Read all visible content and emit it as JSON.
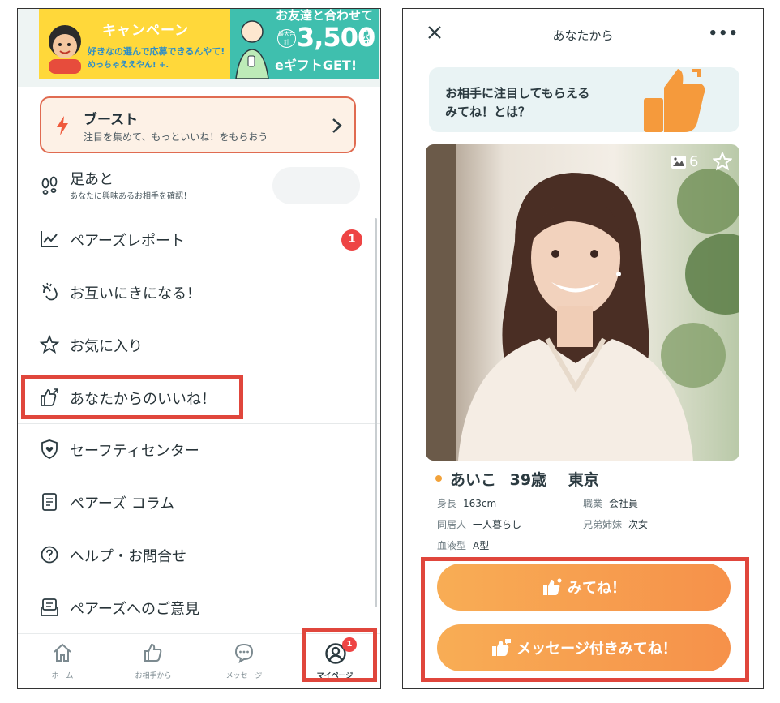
{
  "left": {
    "banner1": {
      "campaign": "キャンペーン",
      "line1": "好きなの選んで応募できるんやて!",
      "line2": "めっちゃええやん! +."
    },
    "banner2": {
      "top": "お友達と合わせて",
      "max": "最大合計",
      "amount": "3,500",
      "unit": "円分",
      "gift": "eギフトGET!"
    },
    "boost": {
      "title": "ブースト",
      "subtitle": "注目を集めて、もっといいね！をもらおう"
    },
    "menu": {
      "footprints": {
        "label": "足あと",
        "sub": "あなたに興味あるお相手を確認！",
        "icon": "footprints-icon"
      },
      "report": {
        "label": "ペアーズレポート",
        "badge": "1",
        "icon": "chart-line-icon"
      },
      "mutual": {
        "label": "お互いにきになる！",
        "icon": "clap-hands-icon"
      },
      "favorites": {
        "label": "お気に入り",
        "icon": "star-outline-icon"
      },
      "likes_sent": {
        "label": "あなたからのいいね！",
        "icon": "thumbs-up-share-icon"
      },
      "safety": {
        "label": "セーフティセンター",
        "icon": "shield-heart-icon"
      },
      "column": {
        "label": "ペアーズ コラム",
        "icon": "document-icon"
      },
      "help": {
        "label": "ヘルプ・お問合せ",
        "icon": "help-circle-icon"
      },
      "feedback": {
        "label": "ペアーズへのご意見",
        "icon": "feedback-icon"
      }
    },
    "tabs": [
      {
        "label": "ホーム",
        "icon": "home-icon"
      },
      {
        "label": "お相手から",
        "icon": "thumbs-up-icon"
      },
      {
        "label": "メッセージ",
        "icon": "chat-bubble-icon"
      },
      {
        "label": "マイページ",
        "icon": "user-circle-icon",
        "badge": "1"
      }
    ]
  },
  "right": {
    "header": {
      "title": "あなたから",
      "more": "•••"
    },
    "info_banner": {
      "line1": "お相手に注目してもらえる",
      "line2": "みてね！とは？"
    },
    "photo": {
      "count": "6"
    },
    "profile": {
      "name": "あいこ",
      "age": "39歳",
      "location": "東京",
      "height": {
        "key": "身長",
        "value": "163cm"
      },
      "job": {
        "key": "職業",
        "value": "会社員"
      },
      "living": {
        "key": "同居人",
        "value": "一人暮らし"
      },
      "siblings": {
        "key": "兄弟姉妹",
        "value": "次女"
      },
      "blood": {
        "key": "血液型",
        "value": "A型"
      }
    },
    "buttons": {
      "mitene": "みてね！",
      "message_mitene": "メッセージ付きみてね！"
    }
  },
  "colors": {
    "accent_orange": "#f6914a",
    "highlight_red": "#e0463c",
    "badge_red": "#ee4444",
    "boost_border": "#e06b51"
  }
}
